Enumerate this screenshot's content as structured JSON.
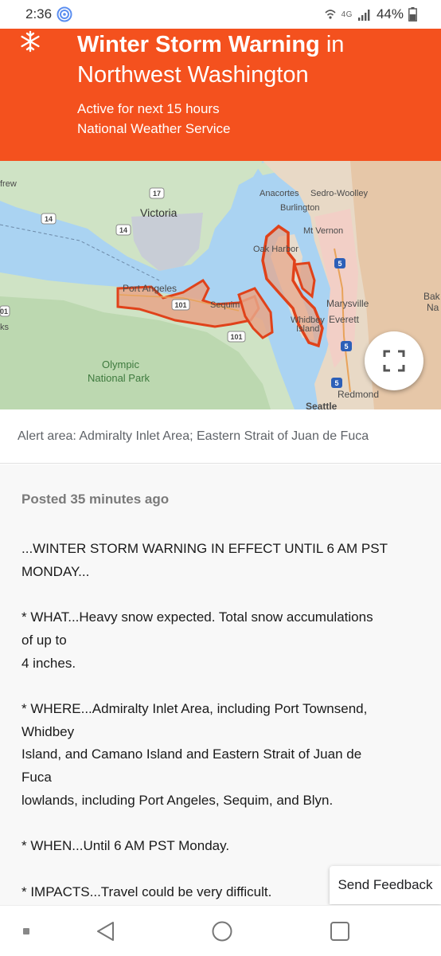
{
  "status_bar": {
    "time": "2:36",
    "network": "4G",
    "battery": "44%"
  },
  "alert": {
    "icon": "snowflake-icon",
    "title_bold": "Winter Storm Warning",
    "title_rest": " in",
    "region": "Northwest Washington",
    "active_text": "Active for next 15 hours",
    "source": "National Weather Service",
    "accent_color": "#f4511e"
  },
  "map": {
    "labels": {
      "victoria": "Victoria",
      "anacortes": "Anacortes",
      "sedro_woolley": "Sedro-Woolley",
      "burlington": "Burlington",
      "mt_vernon": "Mt Vernon",
      "oak_harbor": "Oak Harbor",
      "port_angeles": "Port Angeles",
      "sequim": "Sequim",
      "marysville": "Marysville",
      "whidbey": "Whidbey",
      "island": "Island",
      "everett": "Everett",
      "olympic1": "Olympic",
      "olympic2": "National Park",
      "redmond": "Redmond",
      "seattle": "Seattle",
      "frew": "frew",
      "bak": "Bak",
      "na": "Na",
      "ks": "ks",
      "r17": "17",
      "r14a": "14",
      "r14b": "14",
      "r101a": "101",
      "r101b": "101",
      "r5a": "5",
      "r5b": "5",
      "r5c": "5",
      "r01": "01"
    },
    "expand_icon": "fullscreen-icon"
  },
  "alert_area": "Alert area: Admiralty Inlet Area; Eastern Strait of Juan de Fuca",
  "details": {
    "posted": "Posted 35 minutes ago",
    "body": "...WINTER STORM WARNING IN EFFECT UNTIL 6 AM PST\nMONDAY...\n\n* WHAT...Heavy snow expected. Total snow accumulations\nof up to\n4 inches.\n\n* WHERE...Admiralty Inlet Area, including Port Townsend,\nWhidbey\nIsland, and Camano Island and Eastern Strait of Juan de\nFuca\nlowlands, including Port Angeles, Sequim, and Blyn.\n\n* WHEN...Until 6 AM PST Monday.\n\n* IMPACTS...Travel could be very difficult."
  },
  "feedback_button": "Send Feedback",
  "nav": {
    "recent_icon": "recent-apps-icon",
    "back_icon": "back-icon",
    "home_icon": "home-icon",
    "overview_icon": "overview-icon"
  }
}
